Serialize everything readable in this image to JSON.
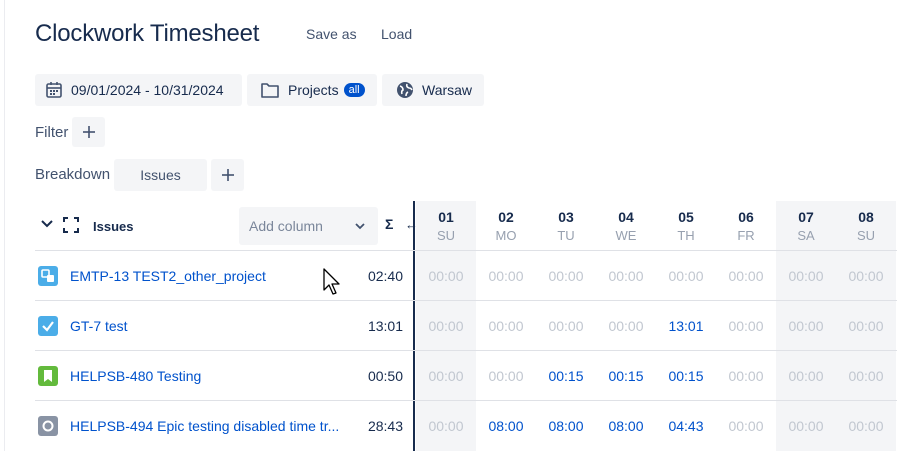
{
  "header": {
    "title": "Clockwork Timesheet",
    "save_as": "Save as",
    "load": "Load"
  },
  "toolbar": {
    "date_range": "09/01/2024 - 10/31/2024",
    "projects_label": "Projects",
    "projects_badge": "all",
    "timezone": "Warsaw"
  },
  "filter": {
    "label": "Filter"
  },
  "breakdown": {
    "label": "Breakdown",
    "chip": "Issues"
  },
  "table": {
    "issues_header": "Issues",
    "add_column_placeholder": "Add column",
    "sigma": "Σ",
    "resize_glyph": "↔",
    "days": [
      {
        "num": "01",
        "name": "SU",
        "weekend": true
      },
      {
        "num": "02",
        "name": "MO",
        "weekend": false
      },
      {
        "num": "03",
        "name": "TU",
        "weekend": false
      },
      {
        "num": "04",
        "name": "WE",
        "weekend": false
      },
      {
        "num": "05",
        "name": "TH",
        "weekend": false
      },
      {
        "num": "06",
        "name": "FR",
        "weekend": false
      },
      {
        "num": "07",
        "name": "SA",
        "weekend": true
      },
      {
        "num": "08",
        "name": "SU",
        "weekend": true
      }
    ],
    "rows": [
      {
        "icon": "subtask-icon",
        "color": "#4bade8",
        "label": "EMTP-13 TEST2_other_project",
        "total": "02:40",
        "cells": [
          "00:00",
          "00:00",
          "00:00",
          "00:00",
          "00:00",
          "00:00",
          "00:00",
          "00:00"
        ]
      },
      {
        "icon": "task-icon",
        "color": "#4bade8",
        "label": "GT-7 test",
        "total": "13:01",
        "cells": [
          "00:00",
          "00:00",
          "00:00",
          "00:00",
          "13:01",
          "00:00",
          "00:00",
          "00:00"
        ]
      },
      {
        "icon": "story-icon",
        "color": "#63ba3c",
        "label": "HELPSB-480 Testing",
        "total": "00:50",
        "cells": [
          "00:00",
          "00:00",
          "00:15",
          "00:15",
          "00:15",
          "00:00",
          "00:00",
          "00:00"
        ]
      },
      {
        "icon": "epic-disabled-icon",
        "color": "#8993a4",
        "label": "HELPSB-494 Epic testing disabled time tr...",
        "total": "28:43",
        "cells": [
          "00:00",
          "08:00",
          "08:00",
          "08:00",
          "04:43",
          "00:00",
          "00:00",
          "00:00"
        ]
      }
    ]
  },
  "colors": {
    "accent": "#0052cc",
    "text": "#172b4d",
    "muted": "#c1c7d0"
  }
}
